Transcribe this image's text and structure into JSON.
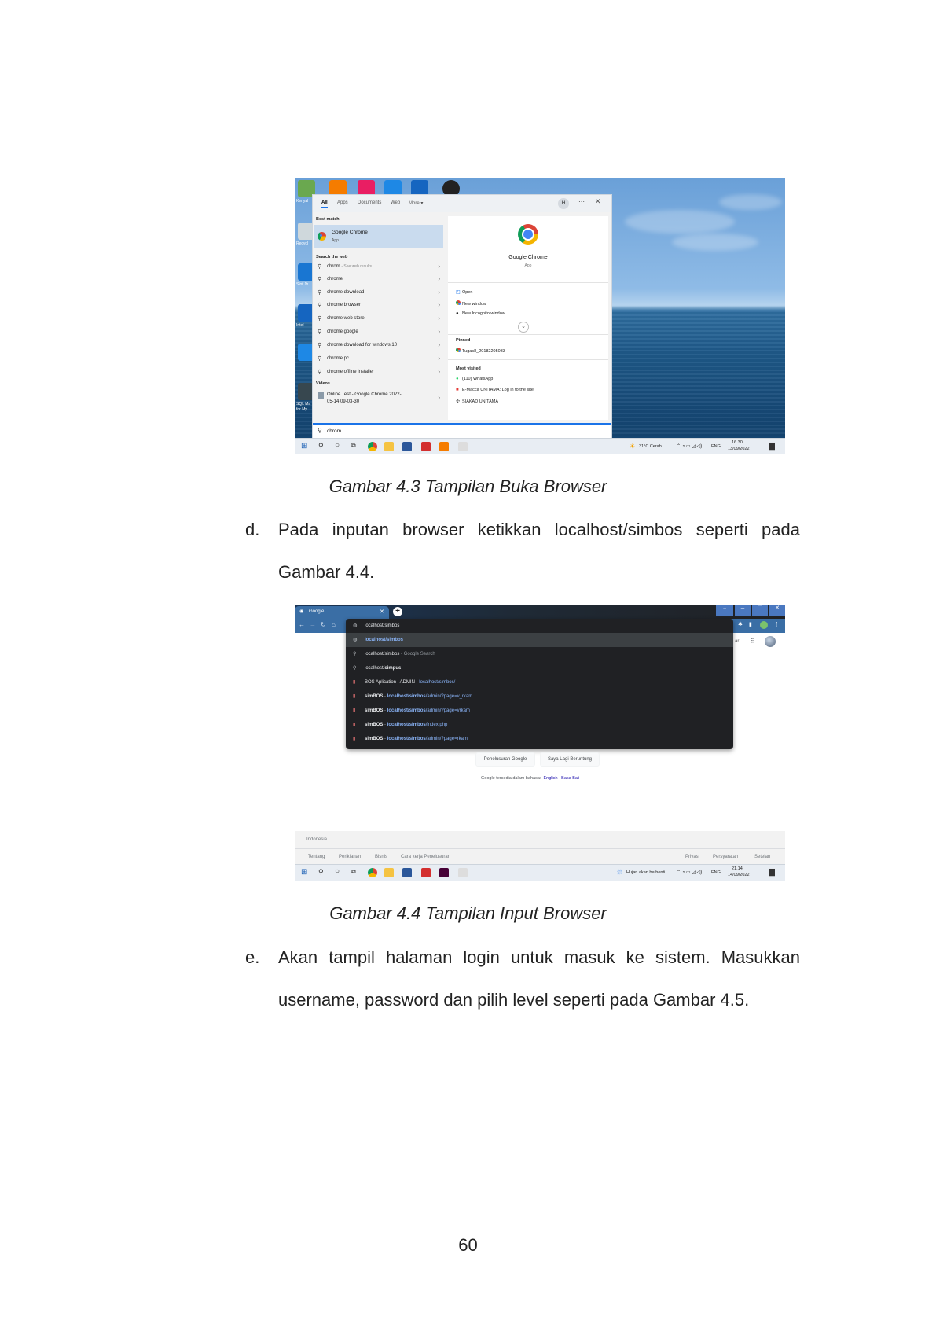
{
  "figure1": {
    "start_menu": {
      "tabs": [
        "All",
        "Apps",
        "Documents",
        "Web",
        "More ▾"
      ],
      "avatar": "H",
      "best_match_heading": "Best match",
      "best_match": {
        "name": "Google Chrome",
        "type": "App"
      },
      "search_web_heading": "Search the web",
      "web_results": [
        {
          "query": "chrom",
          "hint": "See web results"
        },
        {
          "query": "chrome"
        },
        {
          "query": "chrome download"
        },
        {
          "query": "chrome browser"
        },
        {
          "query": "chrome web store"
        },
        {
          "query": "chrome google"
        },
        {
          "query": "chrome download for windows 10"
        },
        {
          "query": "chrome pc"
        },
        {
          "query": "chrome offline installer"
        }
      ],
      "videos_heading": "Videos",
      "video": {
        "line1": "Online Test - Google Chrome 2022-",
        "line2": "05-14 09-03-30"
      },
      "detail": {
        "app_name": "Google Chrome",
        "app_type": "App",
        "actions": [
          "Open",
          "New window",
          "New Incognito window"
        ],
        "pinned_heading": "Pinned",
        "pinned": [
          "Tugas8_20182205033"
        ],
        "most_visited_heading": "Most visited",
        "most_visited": [
          "(110) WhatsApp",
          "E-Macca UNITAMA: Log in to the site",
          "SIAKAD UNITAMA"
        ]
      },
      "search_input": "chrom"
    },
    "desktop_labels": [
      "Kenyal",
      "Recycl",
      "Slot Jh",
      "Intel",
      "SQL Ma",
      "for My"
    ],
    "taskbar": {
      "weather": "31°C Cerah",
      "lang": "ENG",
      "time": "16.30",
      "date": "13/09/2022"
    },
    "caption": "Gambar 4.3 Tampilan Buka Browser"
  },
  "step_d": {
    "marker": "d.",
    "line1": "Pada inputan browser ketikkan localhost/simbos seperti pada",
    "line2": "Gambar 4.4."
  },
  "figure2": {
    "tab_title": "Google",
    "omnibox": {
      "typed": "localhost/simbos",
      "suggestions": [
        {
          "icon": "globe",
          "parts": [
            {
              "t": "localhost/simbos",
              "c": "blue b"
            }
          ]
        },
        {
          "icon": "search",
          "parts": [
            {
              "t": "localhost/simbos",
              "c": ""
            },
            {
              "t": " - Google Search",
              "c": "dim"
            }
          ]
        },
        {
          "icon": "search",
          "parts": [
            {
              "t": "localhost/",
              "c": ""
            },
            {
              "t": "simpus",
              "c": "b"
            }
          ]
        },
        {
          "icon": "page",
          "parts": [
            {
              "t": "BOS Aplication | ADMIN",
              "c": ""
            },
            {
              "t": " - ",
              "c": "dim"
            },
            {
              "t": "localhost/simbos/",
              "c": "blue"
            }
          ]
        },
        {
          "icon": "page",
          "parts": [
            {
              "t": "simBOS",
              "c": "b"
            },
            {
              "t": " - ",
              "c": "dim"
            },
            {
              "t": "localhost/simbos",
              "c": "blue b"
            },
            {
              "t": "/admin/?page=v_rkam",
              "c": "blue"
            }
          ]
        },
        {
          "icon": "page",
          "parts": [
            {
              "t": "simBOS",
              "c": "b"
            },
            {
              "t": " - ",
              "c": "dim"
            },
            {
              "t": "localhost/simbos",
              "c": "blue b"
            },
            {
              "t": "/admin/?page=vrkam",
              "c": "blue"
            }
          ]
        },
        {
          "icon": "page",
          "parts": [
            {
              "t": "simBOS",
              "c": "b"
            },
            {
              "t": " - ",
              "c": "dim"
            },
            {
              "t": "localhost/simbos",
              "c": "blue b"
            },
            {
              "t": "/index.php",
              "c": "blue"
            }
          ]
        },
        {
          "icon": "page",
          "parts": [
            {
              "t": "simBOS",
              "c": "b"
            },
            {
              "t": " - ",
              "c": "dim"
            },
            {
              "t": "localhost/simbos",
              "c": "blue b"
            },
            {
              "t": "/admin/?page=rkam",
              "c": "blue"
            }
          ]
        }
      ]
    },
    "google": {
      "button_search": "Penelusuran Google",
      "button_lucky": "Saya Lagi Beruntung",
      "lang_prefix": "Google tersedia dalam bahasa:",
      "lang_links": [
        "English",
        "Basa Bali"
      ],
      "country": "Indonesia",
      "footer_left": [
        "Tentang",
        "Periklanan",
        "Bisnis",
        "Cara kerja Penelusuran"
      ],
      "footer_right": [
        "Privasi",
        "Persyaratan",
        "Setelan"
      ]
    },
    "taskbar": {
      "weather": "Hujan akan berhenti",
      "lang": "ENG",
      "time": "21.14",
      "date": "14/09/2022"
    },
    "caption": "Gambar 4.4 Tampilan Input Browser"
  },
  "step_e": {
    "marker": "e.",
    "line1": "Akan tampil halaman login untuk masuk ke sistem. Masukkan",
    "line2": "username, password dan pilih level seperti pada Gambar 4.5."
  },
  "page_number": "60"
}
